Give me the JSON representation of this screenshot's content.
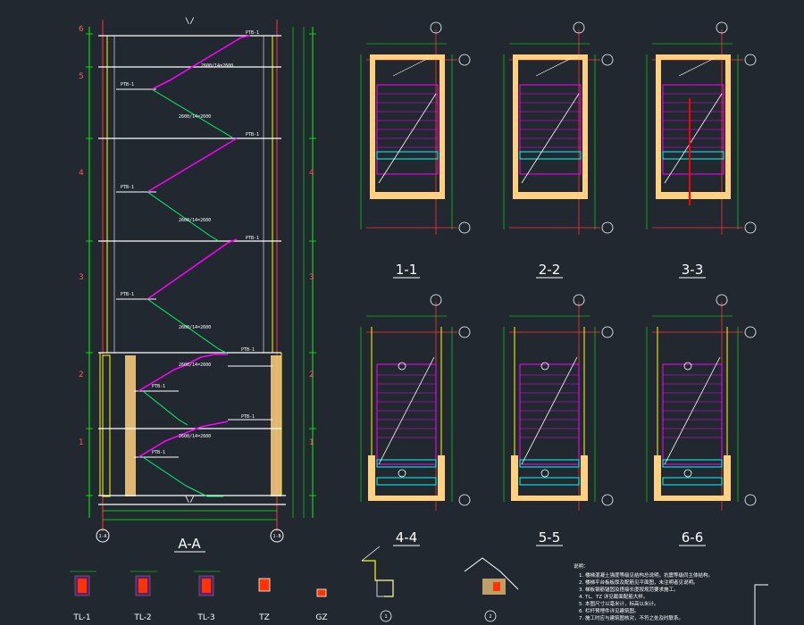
{
  "section_main": {
    "title": "A-A",
    "levels": [
      "6",
      "5",
      "4",
      "3",
      "2",
      "1"
    ],
    "grid_left": "1-A",
    "grid_right": "1-B"
  },
  "plans": [
    {
      "title": "1-1"
    },
    {
      "title": "2-2"
    },
    {
      "title": "3-3"
    },
    {
      "title": "4-4"
    },
    {
      "title": "5-5"
    },
    {
      "title": "6-6"
    }
  ],
  "details": [
    {
      "title": "TL-1"
    },
    {
      "title": "TL-2"
    },
    {
      "title": "TL-3"
    },
    {
      "title": "TZ"
    },
    {
      "title": "GZ"
    },
    {
      "title": "1"
    },
    {
      "title": "2"
    }
  ],
  "notes": {
    "heading": "说明：",
    "lines": [
      "1. 楼梯混凝土强度等级见结构总说明，抗震等级同主体结构。",
      "2. 楼梯平台板板厚及配筋见平面图，未注明者见说明。",
      "3. 梯板钢筋锚固及搭接长度按规范要求施工。",
      "4. TL、TZ 详见截面配筋大样。",
      "5. 本图尺寸以毫米计，标高以米计。",
      "6. 栏杆预埋件详见建筑图。",
      "7. 施工时应与建筑图核对，不符之处及时联系。"
    ]
  },
  "colors": {
    "background": "#212830",
    "wall": "#ffff00",
    "stair": "#ff00ff",
    "flight": "#00ff66",
    "dimension": "#00ff00",
    "grid_line": "#ff3333",
    "hatch": "#ffd080",
    "beam": "#00ffff",
    "text": "#ffffff"
  }
}
